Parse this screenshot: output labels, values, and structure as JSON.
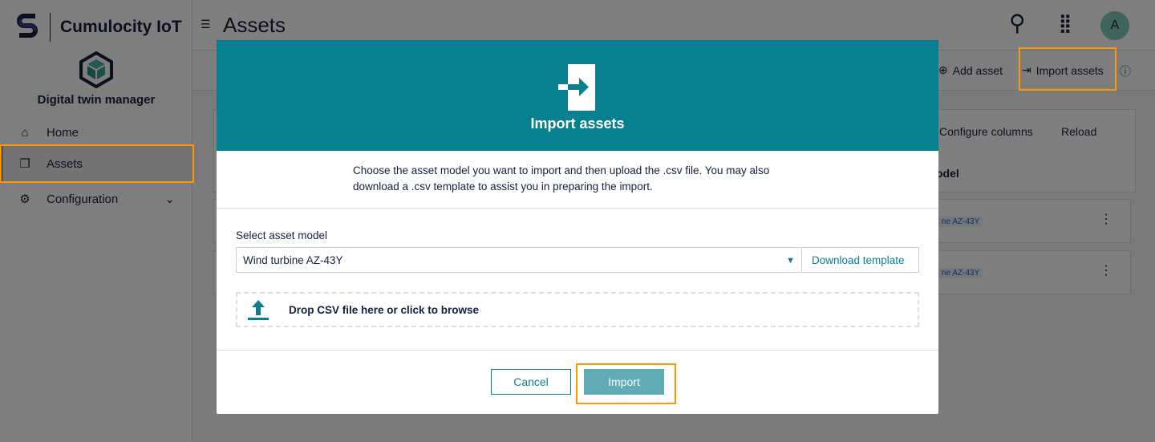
{
  "brand": {
    "name": "Cumulocity IoT",
    "app_name": "Digital twin manager"
  },
  "sidebar": {
    "items": [
      {
        "label": "Home",
        "icon": "home-icon"
      },
      {
        "label": "Assets",
        "icon": "cubes-icon",
        "active": true
      },
      {
        "label": "Configuration",
        "icon": "gear-icon"
      }
    ]
  },
  "header": {
    "title": "Assets",
    "avatar": "A"
  },
  "actions": {
    "add_asset": "Add asset",
    "import_assets": "Import assets"
  },
  "card": {
    "configure_columns": "Configure columns",
    "reload": "Reload",
    "column_fragment": "odel",
    "rows": [
      "ne AZ-43Y",
      "ne AZ-43Y"
    ]
  },
  "modal": {
    "title": "Import assets",
    "description": "Choose the asset model you want to import and then upload the .csv file. You may also download a .csv template to assist you in preparing the import.",
    "select_label": "Select asset model",
    "select_value": "Wind turbine AZ-43Y",
    "download_template": "Download template",
    "drop_text": "Drop CSV file here or click to browse",
    "cancel": "Cancel",
    "import": "Import"
  },
  "colors": {
    "accent": "#088090",
    "highlight": "#ff9800"
  }
}
